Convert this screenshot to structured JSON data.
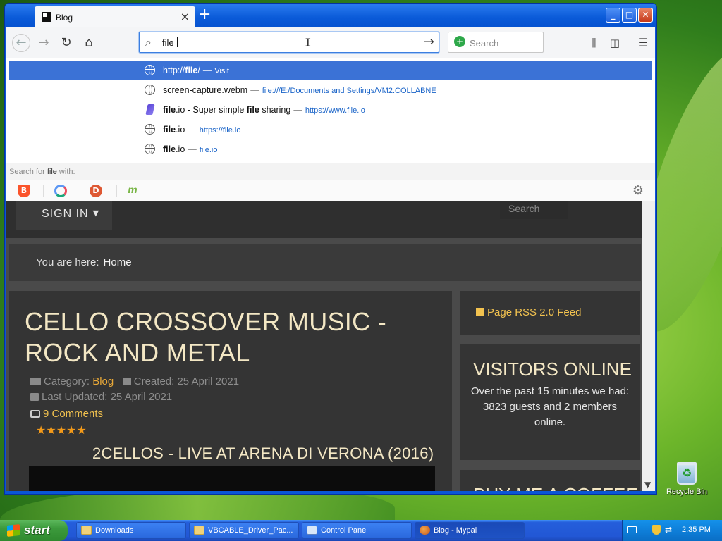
{
  "desktop": {
    "recycle_bin_label": "Recycle Bin"
  },
  "browser": {
    "tab_title": "Blog",
    "url_value": "file ",
    "search_placeholder": "Search",
    "window_buttons": {
      "minimize": "_",
      "maximize": "□",
      "close": "✕"
    }
  },
  "suggestions": [
    {
      "prefix": "http://",
      "bold": "file",
      "suffix": "/",
      "sep": "—",
      "url": "Visit",
      "icon": "globe-icon",
      "selected": true
    },
    {
      "prefix": "screen-capture.webm",
      "bold": "",
      "suffix": "",
      "sep": "—",
      "url": "file:///E:/Documents and Settings/VM2.COLLABNE",
      "icon": "globe-icon",
      "selected": false
    },
    {
      "prefix": "",
      "bold": "file",
      "suffix": ".io - Super simple ",
      "bold2": "file",
      "suffix2": " sharing",
      "sep": "—",
      "url": "https://www.file.io",
      "icon": "fileio-icon",
      "selected": false
    },
    {
      "prefix": "",
      "bold": "file",
      "suffix": ".io",
      "sep": "—",
      "url": "https://file.io",
      "icon": "globe-icon",
      "selected": false
    },
    {
      "prefix": "",
      "bold": "file",
      "suffix": ".io",
      "sep": "—",
      "url": "file.io",
      "icon": "globe-icon",
      "selected": false
    }
  ],
  "search_with": {
    "prefix": "Search for ",
    "term": "file",
    "suffix": " with:"
  },
  "engines": [
    "brave-icon",
    "qwant-icon",
    "duckduckgo-icon",
    "mojeek-icon"
  ],
  "page": {
    "signin": "SIGN IN",
    "search_placeholder": "Search",
    "breadcrumb_label": "You are here:",
    "breadcrumb_item": "Home",
    "article": {
      "title": "CELLO CROSSOVER MUSIC - ROCK AND METAL",
      "category_label": "Category:",
      "category_value": "Blog",
      "created": "Created: 25 April 2021",
      "updated": "Last Updated: 25 April 2021",
      "comments": "9 Comments",
      "stars": "★★★★★",
      "subtitle": "2CELLOS - LIVE AT ARENA DI VERONA (2016)"
    },
    "sidebar": {
      "rss": "Page RSS 2.0 Feed",
      "visitors_title": "VISITORS ONLINE",
      "visitors_text": "Over the past 15 minutes we had: 3823 guests and 2 members online.",
      "coffee_title": "BUY ME A COFFEE"
    }
  },
  "taskbar": {
    "start": "start",
    "buttons": [
      {
        "label": "Downloads",
        "icon": "folder-icon"
      },
      {
        "label": "VBCABLE_Driver_Pac...",
        "icon": "folder-icon"
      },
      {
        "label": "Control Panel",
        "icon": "control-panel-icon"
      },
      {
        "label": "Blog - Mypal",
        "icon": "mypal-icon"
      }
    ],
    "clock": "2:35 PM"
  }
}
